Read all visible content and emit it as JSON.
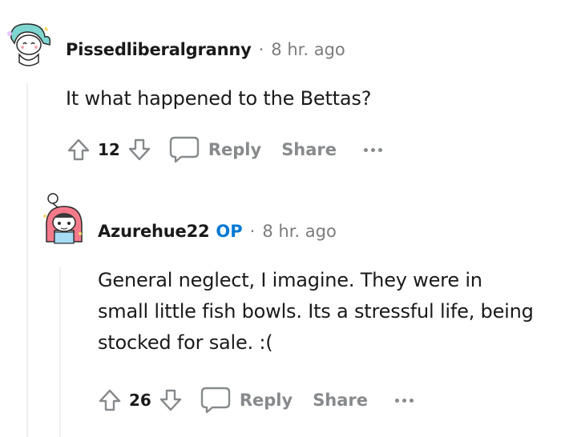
{
  "comments": [
    {
      "username": "Pissedliberalgranny",
      "op_badge": "",
      "separator": "·",
      "timestamp": "8 hr. ago",
      "body": "It what happened to the Bettas?",
      "score": "12",
      "reply_label": "Reply",
      "share_label": "Share",
      "avatar_icon": "snoo-avatar-teal-hair"
    },
    {
      "username": "Azurehue22",
      "op_badge": "OP",
      "separator": "·",
      "timestamp": "8 hr. ago",
      "body": "General neglect, I imagine. They were in small little fish bowls. Its a stressful life, being stocked for sale. :(",
      "score": "26",
      "reply_label": "Reply",
      "share_label": "Share",
      "avatar_icon": "snoo-avatar-pink-hood"
    }
  ],
  "colors": {
    "op_blue": "#0079d3",
    "muted_gray": "#878a8c",
    "text": "#1a1a1b",
    "thread_line": "#edeff1"
  }
}
